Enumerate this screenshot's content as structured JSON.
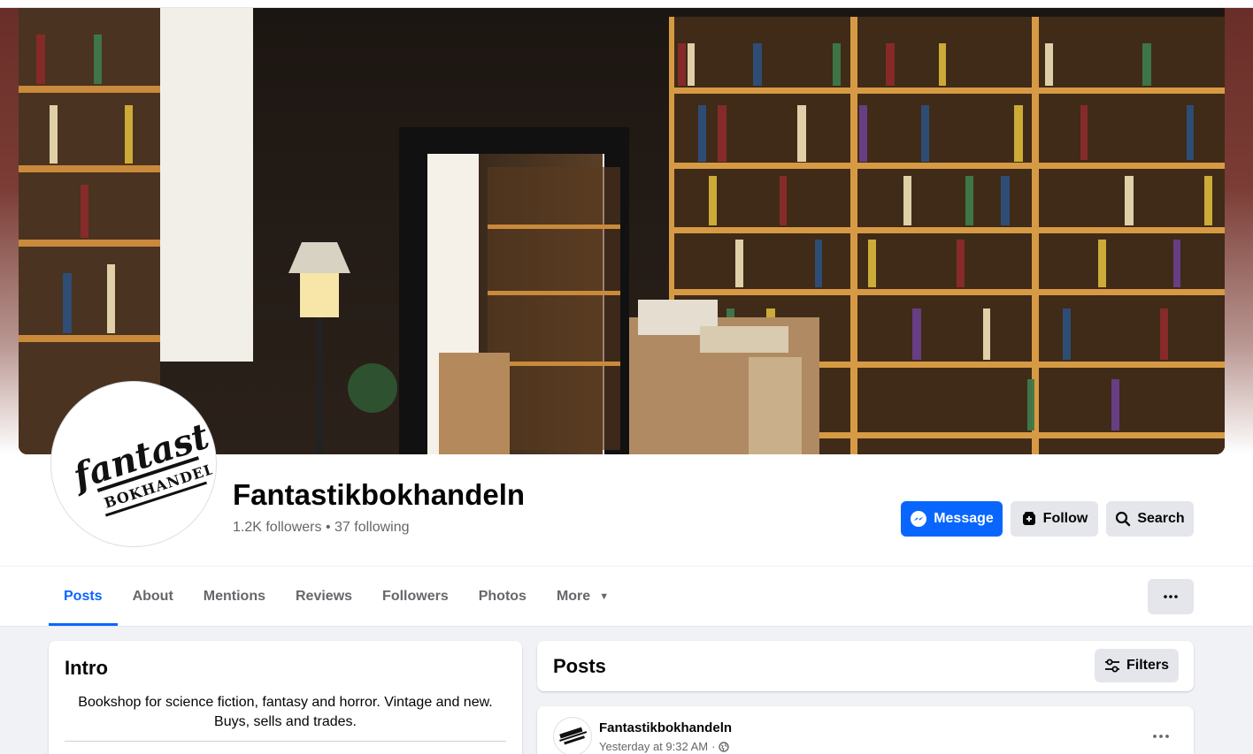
{
  "page": {
    "name": "Fantastikbokhandeln",
    "followers": "1.2K followers",
    "separator": "•",
    "following": "37 following",
    "logo_text": [
      "fantastik",
      "BOKHANDELN"
    ]
  },
  "actions": {
    "message_label": "Message",
    "follow_label": "Follow",
    "search_label": "Search"
  },
  "tabs": [
    {
      "label": "Posts",
      "active": true
    },
    {
      "label": "About"
    },
    {
      "label": "Mentions"
    },
    {
      "label": "Reviews"
    },
    {
      "label": "Followers"
    },
    {
      "label": "Photos"
    },
    {
      "label": "More"
    }
  ],
  "intro": {
    "title": "Intro",
    "bio": "Bookshop for science fiction, fantasy and horror. Vintage and new. Buys, sells and trades."
  },
  "posts": {
    "title": "Posts",
    "filters_label": "Filters",
    "first_post": {
      "author": "Fantastikbokhandeln",
      "time": "Yesterday at 9:32 AM",
      "dot": "·",
      "audience_icon": "globe-icon"
    }
  },
  "colors": {
    "accent": "#0866ff",
    "secondary_button": "#e4e6eb",
    "muted_text": "#65676b",
    "feed_background": "#f0f2f5"
  },
  "icons": [
    "messenger-icon",
    "follow-icon",
    "search-icon",
    "caret-down-icon",
    "more-dots-icon",
    "filters-icon",
    "globe-icon"
  ]
}
